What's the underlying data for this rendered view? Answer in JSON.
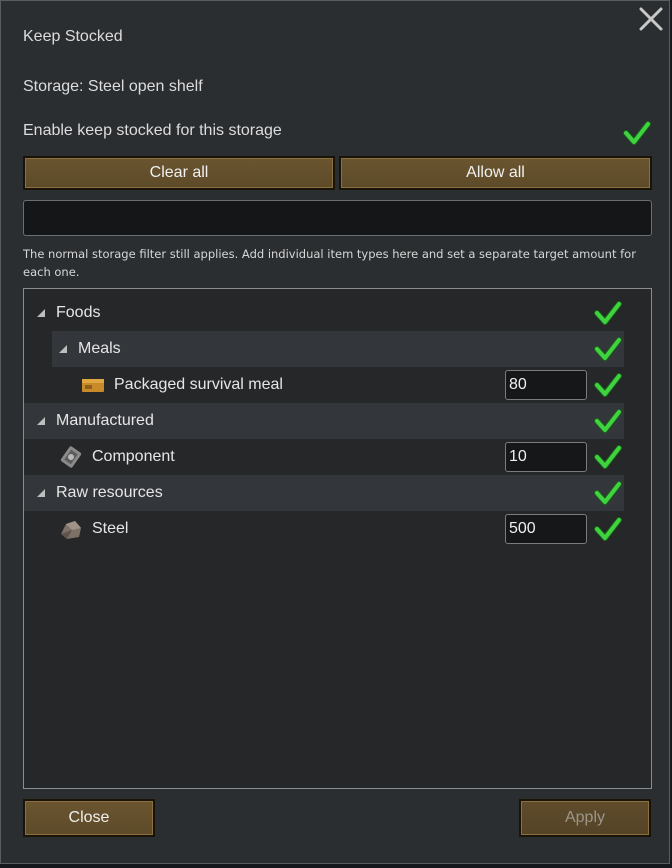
{
  "dialog": {
    "title": "Keep Stocked",
    "storage_label": "Storage: Steel open shelf",
    "enable_label": "Enable keep stocked for this storage",
    "clear_all": "Clear all",
    "allow_all": "Allow all",
    "search_value": "",
    "note": "The normal storage filter still applies. Add individual item types here and set a separate target amount for each one.",
    "close": "Close",
    "apply": "Apply"
  },
  "tree": {
    "foods": {
      "label": "Foods"
    },
    "meals": {
      "label": "Meals"
    },
    "packaged_meal": {
      "label": "Packaged survival meal",
      "amount": "80"
    },
    "manufactured": {
      "label": "Manufactured"
    },
    "component": {
      "label": "Component",
      "amount": "10"
    },
    "raw_resources": {
      "label": "Raw resources"
    },
    "steel": {
      "label": "Steel",
      "amount": "500"
    }
  },
  "colors": {
    "check": "#3fd43f",
    "button": "#6a5530",
    "panel": "#2b2e31"
  }
}
